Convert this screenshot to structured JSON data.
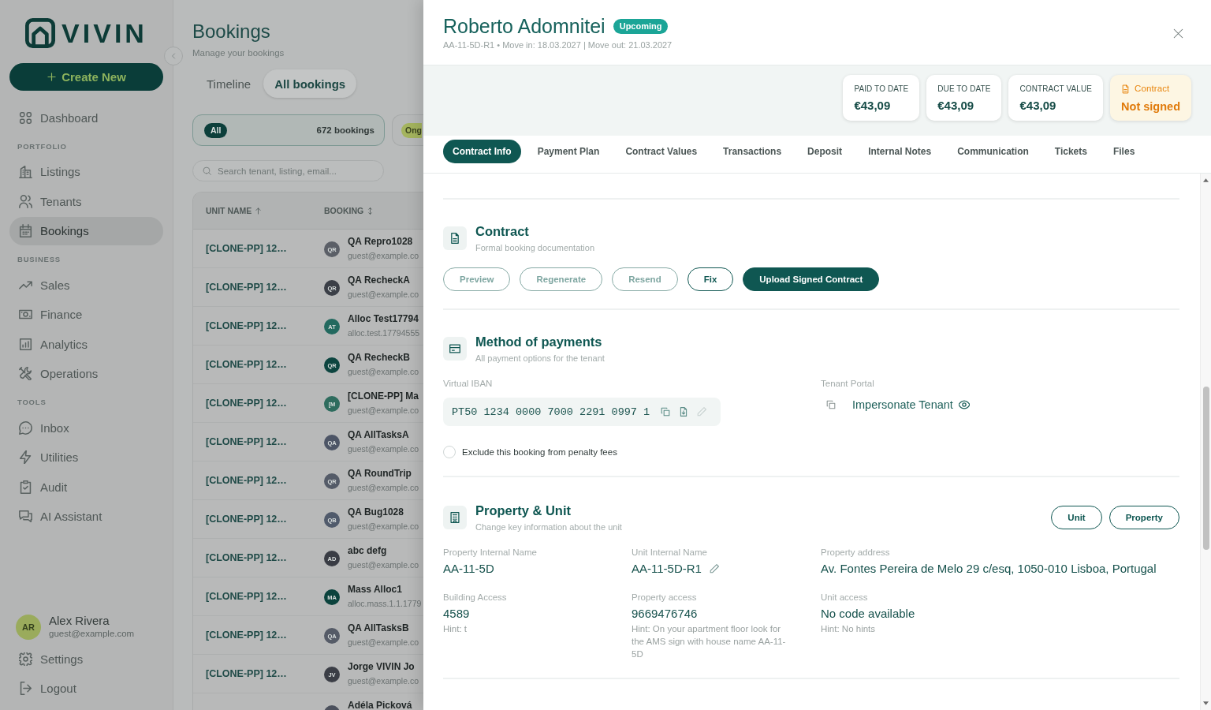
{
  "sidebar": {
    "logo": "VIVIN",
    "create_button": "Create New",
    "nav": [
      {
        "kind": "item",
        "label": "Dashboard",
        "selected": false
      },
      {
        "kind": "heading",
        "label": "PORTFOLIO"
      },
      {
        "kind": "item",
        "label": "Listings",
        "selected": false
      },
      {
        "kind": "item",
        "label": "Tenants",
        "selected": false
      },
      {
        "kind": "item",
        "label": "Bookings",
        "selected": true
      },
      {
        "kind": "heading",
        "label": "BUSINESS"
      },
      {
        "kind": "item",
        "label": "Sales",
        "selected": false
      },
      {
        "kind": "item",
        "label": "Finance",
        "selected": false
      },
      {
        "kind": "item",
        "label": "Analytics",
        "selected": false
      },
      {
        "kind": "item",
        "label": "Operations",
        "selected": false
      },
      {
        "kind": "heading",
        "label": "TOOLS"
      },
      {
        "kind": "item",
        "label": "Inbox",
        "selected": false
      },
      {
        "kind": "item",
        "label": "Utilities",
        "selected": false
      },
      {
        "kind": "item",
        "label": "Audit",
        "selected": false
      },
      {
        "kind": "item",
        "label": "AI Assistant",
        "selected": false
      }
    ],
    "user": {
      "initials": "AR",
      "name": "Alex Rivera",
      "email": "guest@example.com"
    },
    "footer": [
      "Settings",
      "Logout"
    ]
  },
  "bookings_page": {
    "title": "Bookings",
    "subtitle": "Manage your bookings",
    "view_tabs": [
      {
        "label": "Timeline",
        "selected": false
      },
      {
        "label": "All bookings",
        "selected": true
      }
    ],
    "filters": [
      {
        "badge": "All",
        "count": "672 bookings",
        "selected": true,
        "color": "#0c3f3b"
      },
      {
        "badge": "Ong",
        "selected": false,
        "color": "#a4b45e"
      }
    ],
    "search": {
      "placeholder": "Search tenant, listing, email..."
    },
    "table": {
      "columns": [
        {
          "label": "UNIT NAME",
          "sorted": true
        },
        {
          "label": "BOOKING",
          "sorted": false
        }
      ],
      "rows": [
        {
          "unit": "[CLONE-PP] 12…",
          "initials": "QR",
          "color": "#5b5f67",
          "name": "QA Repro1028",
          "email": "guest@example.co"
        },
        {
          "unit": "[CLONE-PP] 12…",
          "initials": "QR",
          "color": "#3b3f47",
          "name": "QA RecheckA",
          "email": "guest@example.co"
        },
        {
          "unit": "[CLONE-PP] 12…",
          "initials": "AT",
          "color": "#22695f",
          "name": "Alloc Test17794",
          "email": "alloc.test.17794555"
        },
        {
          "unit": "[CLONE-PP] 12…",
          "initials": "QR",
          "color": "#0d4540",
          "name": "QA RecheckB",
          "email": "guest@example.co"
        },
        {
          "unit": "[CLONE-PP] 12…",
          "initials": "[M",
          "color": "#2e6c5e",
          "name": "[CLONE-PP] Ma",
          "email": "guest@example.co"
        },
        {
          "unit": "[CLONE-PP] 12…",
          "initials": "QA",
          "color": "#4d5566",
          "name": "QA AllTasksA",
          "email": "guest@example.co"
        },
        {
          "unit": "[CLONE-PP] 12…",
          "initials": "QR",
          "color": "#545b68",
          "name": "QA RoundTrip",
          "email": "guest@example.co"
        },
        {
          "unit": "[CLONE-PP] 12…",
          "initials": "QB",
          "color": "#505a6b",
          "name": "QA Bug1028",
          "email": "guest@example.co"
        },
        {
          "unit": "[CLONE-PP] 12…",
          "initials": "AD",
          "color": "#393c44",
          "name": "abc defg",
          "email": "guest@example.co"
        },
        {
          "unit": "[CLONE-PP] 12…",
          "initials": "MA",
          "color": "#0b433d",
          "name": "Mass Alloc1",
          "email": "alloc.mass.1.1.1779"
        },
        {
          "unit": "[CLONE-PP] 12…",
          "initials": "QA",
          "color": "#555b67",
          "name": "QA AllTasksB",
          "email": "guest@example.co"
        },
        {
          "unit": "[CLONE-PP] 12…",
          "initials": "JV",
          "color": "#3b3e46",
          "name": "Jorge VIVIN Jo",
          "email": "guest@example.co"
        },
        {
          "color": "#4c515d",
          "name": "Adéla Picková"
        }
      ]
    }
  },
  "booking_drawer": {
    "name": "Roberto Adomnitei",
    "status": "Upcoming",
    "meta": "AA-11-5D-R1 • Move in: 18.03.2027 | Move out: 21.03.2027",
    "stats": [
      {
        "kind": "amount",
        "label": "PAID TO DATE",
        "value": "€43,09"
      },
      {
        "kind": "amount",
        "label": "DUE TO DATE",
        "value": "€43,09"
      },
      {
        "kind": "amount",
        "label": "CONTRACT VALUE",
        "value": "€43,09"
      },
      {
        "kind": "warning",
        "label": "Contract",
        "value": "Not signed"
      }
    ],
    "tabs": [
      {
        "label": "Contract Info",
        "selected": true
      },
      {
        "label": "Payment Plan",
        "selected": false
      },
      {
        "label": "Contract Values",
        "selected": false
      },
      {
        "label": "Transactions",
        "selected": false
      },
      {
        "label": "Deposit",
        "selected": false
      },
      {
        "label": "Internal Notes",
        "selected": false
      },
      {
        "label": "Communication",
        "selected": false
      },
      {
        "label": "Tickets",
        "selected": false
      },
      {
        "label": "Files",
        "selected": false
      }
    ],
    "contract": {
      "title": "Contract",
      "subtitle": "Formal booking documentation",
      "buttons": [
        {
          "label": "Preview",
          "kind": "outline",
          "disabled": true
        },
        {
          "label": "Regenerate",
          "kind": "outline",
          "disabled": true
        },
        {
          "label": "Resend",
          "kind": "outline",
          "disabled": true
        },
        {
          "label": "Fix",
          "kind": "outline",
          "disabled": false
        },
        {
          "label": "Upload Signed Contract",
          "kind": "filled",
          "disabled": false
        }
      ]
    },
    "payments": {
      "title": "Method of payments",
      "subtitle": "All payment options for the tenant",
      "iban_label": "Virtual IBAN",
      "iban": "PT50 1234 0000 7000 2291 0997 1",
      "iban_actions": [
        {
          "kind": "copy",
          "disabled": false
        },
        {
          "kind": "download",
          "disabled": false
        },
        {
          "kind": "edit",
          "disabled": true
        }
      ],
      "portal_label": "Tenant Portal",
      "impersonate_link": "Impersonate Tenant",
      "penalty_exclusion": {
        "label": "Exclude this booking from penalty fees",
        "checked": false
      }
    },
    "property": {
      "title": "Property & Unit",
      "subtitle": "Change key information about the unit",
      "buttons": [
        "Unit",
        "Property"
      ],
      "fields": [
        {
          "label": "Property Internal Name",
          "value": "AA-11-5D",
          "editable": false
        },
        {
          "label": "Unit Internal Name",
          "value": "AA-11-5D-R1",
          "editable": true
        },
        {
          "label": "Property address",
          "value": "Av. Fontes Pereira de Melo 29 c/esq, 1050-010 Lisboa, Portugal",
          "editable": false
        },
        {
          "label": "Building Access",
          "value": "4589",
          "hint": "Hint: t",
          "editable": false
        },
        {
          "label": "Property access",
          "value": "9669476746",
          "hint": "Hint: On your apartment floor look for the AMS sign with house name AA-11-5D",
          "editable": false
        },
        {
          "label": "Unit access",
          "value": "No code available",
          "hint": "Hint: No hints",
          "editable": false
        }
      ]
    }
  }
}
